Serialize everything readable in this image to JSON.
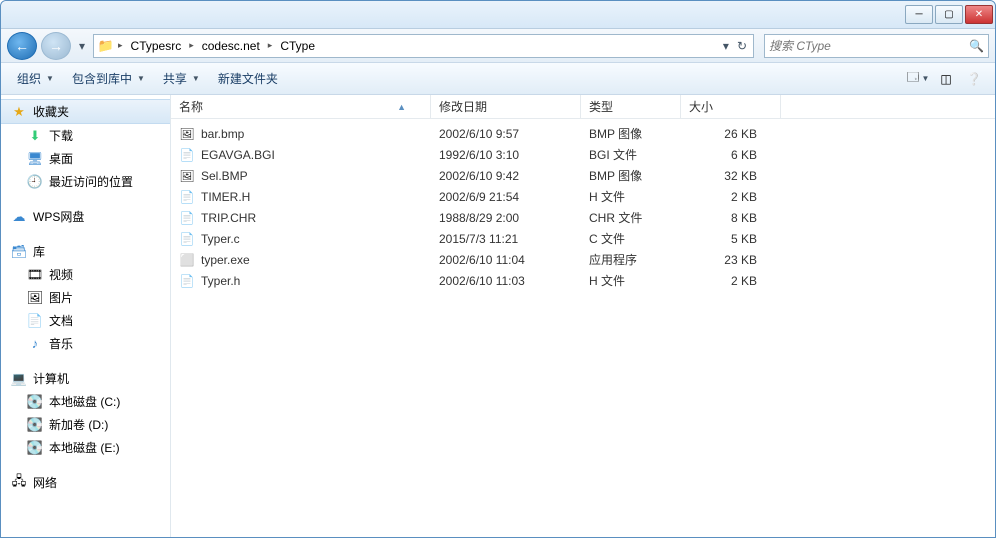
{
  "breadcrumb": [
    "CTypesrc",
    "codesc.net",
    "CType"
  ],
  "search_placeholder": "搜索 CType",
  "toolbar": {
    "organize": "组织",
    "include": "包含到库中",
    "share": "共享",
    "newfolder": "新建文件夹"
  },
  "sidebar": {
    "favorites": {
      "label": "收藏夹",
      "items": [
        {
          "icon": "download-icon",
          "label": "下载"
        },
        {
          "icon": "desktop-icon",
          "label": "桌面"
        },
        {
          "icon": "recent-icon",
          "label": "最近访问的位置"
        }
      ]
    },
    "wps": {
      "icon": "cloud-icon",
      "label": "WPS网盘"
    },
    "libraries": {
      "label": "库",
      "items": [
        {
          "icon": "video-icon",
          "label": "视频"
        },
        {
          "icon": "pictures-icon",
          "label": "图片"
        },
        {
          "icon": "documents-icon",
          "label": "文档"
        },
        {
          "icon": "music-icon",
          "label": "音乐"
        }
      ]
    },
    "computer": {
      "label": "计算机",
      "items": [
        {
          "icon": "drive-icon",
          "label": "本地磁盘 (C:)"
        },
        {
          "icon": "drive-icon",
          "label": "新加卷 (D:)"
        },
        {
          "icon": "drive-icon",
          "label": "本地磁盘 (E:)"
        }
      ]
    },
    "network": {
      "icon": "network-icon",
      "label": "网络"
    }
  },
  "columns": {
    "name": "名称",
    "date": "修改日期",
    "type": "类型",
    "size": "大小"
  },
  "files": [
    {
      "icon": "bmp-icon",
      "name": "bar.bmp",
      "date": "2002/6/10 9:57",
      "type": "BMP 图像",
      "size": "26 KB"
    },
    {
      "icon": "file-icon",
      "name": "EGAVGA.BGI",
      "date": "1992/6/10 3:10",
      "type": "BGI 文件",
      "size": "6 KB"
    },
    {
      "icon": "bmp-icon",
      "name": "Sel.BMP",
      "date": "2002/6/10 9:42",
      "type": "BMP 图像",
      "size": "32 KB"
    },
    {
      "icon": "file-icon",
      "name": "TIMER.H",
      "date": "2002/6/9 21:54",
      "type": "H 文件",
      "size": "2 KB"
    },
    {
      "icon": "file-icon",
      "name": "TRIP.CHR",
      "date": "1988/8/29 2:00",
      "type": "CHR 文件",
      "size": "8 KB"
    },
    {
      "icon": "file-icon",
      "name": "Typer.c",
      "date": "2015/7/3 11:21",
      "type": "C 文件",
      "size": "5 KB"
    },
    {
      "icon": "exe-icon",
      "name": "typer.exe",
      "date": "2002/6/10 11:04",
      "type": "应用程序",
      "size": "23 KB"
    },
    {
      "icon": "file-icon",
      "name": "Typer.h",
      "date": "2002/6/10 11:03",
      "type": "H 文件",
      "size": "2 KB"
    }
  ]
}
